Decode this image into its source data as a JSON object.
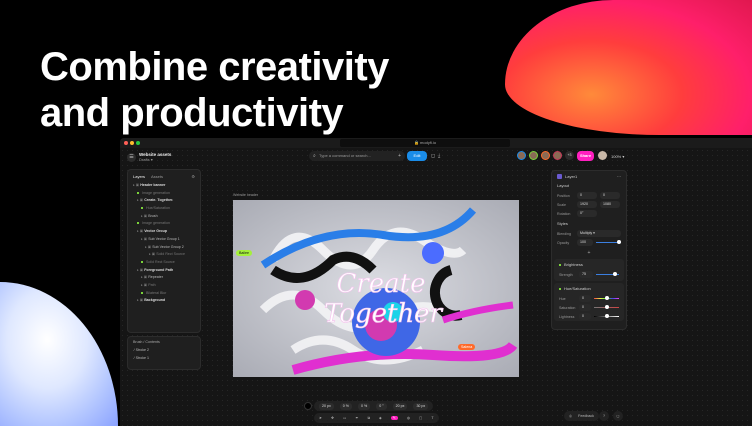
{
  "headline": {
    "line1": "Combine creativity",
    "line2": "and productivity"
  },
  "browser": {
    "url": "modyfi.io"
  },
  "project": {
    "title": "Website assets",
    "subtitle": "Drafts ▾"
  },
  "command": {
    "placeholder": "Type a command or search..."
  },
  "edit_label": "Edit",
  "share_label": "Share",
  "collab_count": "+3",
  "zoom": "100%",
  "layers_panel": {
    "tabs": [
      "Layers",
      "Assets"
    ],
    "items": [
      {
        "label": "Header banner",
        "bold": true,
        "indent": 0
      },
      {
        "label": "Image generation",
        "indent": 1,
        "dim": true,
        "dot": true
      },
      {
        "label": "Create. Together.",
        "bold": true,
        "indent": 1
      },
      {
        "label": "Hue/Saturation",
        "indent": 2,
        "dim": true,
        "dot": true
      },
      {
        "label": "Brush",
        "indent": 2
      },
      {
        "label": "Image generation",
        "indent": 1,
        "dim": true,
        "dot": true
      },
      {
        "label": "Vector Group",
        "bold": true,
        "indent": 1
      },
      {
        "label": "Sub Vector Group 1",
        "indent": 2
      },
      {
        "label": "Sub Vector Group 2",
        "indent": 3
      },
      {
        "label": "Solid Rect Source",
        "indent": 4,
        "dim": true
      },
      {
        "label": "Solid Rect Source",
        "indent": 2,
        "dim": true,
        "dot": true
      },
      {
        "label": "Foreground Path",
        "bold": true,
        "indent": 1
      },
      {
        "label": "Repeater",
        "indent": 2
      },
      {
        "label": "Path",
        "indent": 2,
        "dim": true
      },
      {
        "label": "Bilateral Blur",
        "indent": 2,
        "dim": true,
        "dot": true
      },
      {
        "label": "Background",
        "bold": true,
        "indent": 1
      }
    ]
  },
  "brush_panel": {
    "title": "Brush / Contents",
    "items": [
      "Stroke 2",
      "Stroke 1"
    ]
  },
  "canvas": {
    "frame_label": "Website header",
    "art_title_1": "Create",
    "art_title_2": "Together",
    "cursor_1": "Bailee",
    "cursor_2": "Salena"
  },
  "inspector": {
    "title": "Layer1",
    "layout_label": "Layout",
    "position": {
      "label": "Position",
      "x": "0",
      "x_unit": "X",
      "y": "0",
      "y_unit": "Y"
    },
    "scale": {
      "label": "Scale",
      "w": "1920",
      "w_unit": "W",
      "h": "1080",
      "h_unit": "H"
    },
    "rotation": {
      "label": "Rotation",
      "value": "0°"
    },
    "styles_label": "Styles",
    "blending": {
      "label": "Blending",
      "value": "Multiply"
    },
    "opacity": {
      "label": "Opacity",
      "value": "100",
      "unit": "%",
      "fraction": 1.0
    },
    "add_label": "+",
    "brightness": {
      "title": "Brightness",
      "strength_label": "Strength",
      "strength": "75",
      "unit": "%",
      "fraction": 0.75
    },
    "hue_sat": {
      "title": "Hue/Saturation",
      "hue_label": "Hue",
      "hue": "0",
      "sat_label": "Saturation",
      "sat": "0",
      "light_label": "Lightness",
      "light": "0",
      "unit": "%"
    }
  },
  "bottom_values": [
    "20 px",
    "0 %",
    "0 %",
    "0 °",
    "20 px",
    "30 px"
  ],
  "feedback_label": "Feedback",
  "colors": {
    "accent": "#1a8ce8",
    "share": "#ff1fbf",
    "green": "#7bd33a"
  }
}
